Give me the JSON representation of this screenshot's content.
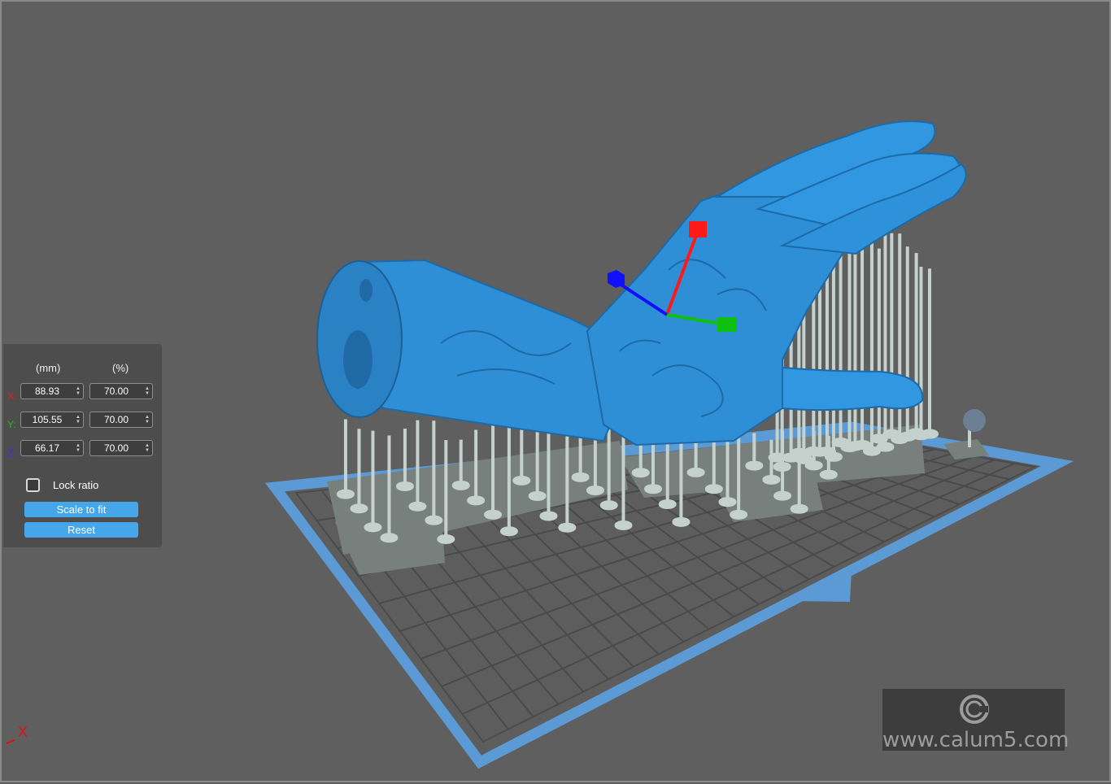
{
  "scale_panel": {
    "header_mm": "(mm)",
    "header_pct": "(%)",
    "rows": [
      {
        "axis": "X:",
        "mm": "88.93",
        "pct": "70.00",
        "color": "#e02020"
      },
      {
        "axis": "Y:",
        "mm": "105.55",
        "pct": "70.00",
        "color": "#20c020"
      },
      {
        "axis": "Z:",
        "mm": "66.17",
        "pct": "70.00",
        "color": "#3030ff"
      }
    ],
    "lock_ratio_label": "Lock ratio",
    "lock_ratio_checked": false,
    "scale_to_fit_label": "Scale to fit",
    "reset_label": "Reset"
  },
  "axis_indicator": {
    "label": "X"
  },
  "watermark": {
    "text": "www.calum5.com"
  },
  "colors": {
    "model": "#2f8fd6",
    "supports": "#c5d1cd",
    "plate_border": "#5b9ad4",
    "gizmo_x": "#ff1a1a",
    "gizmo_y": "#10c010",
    "gizmo_z": "#1010ff",
    "button": "#45a7ea"
  }
}
